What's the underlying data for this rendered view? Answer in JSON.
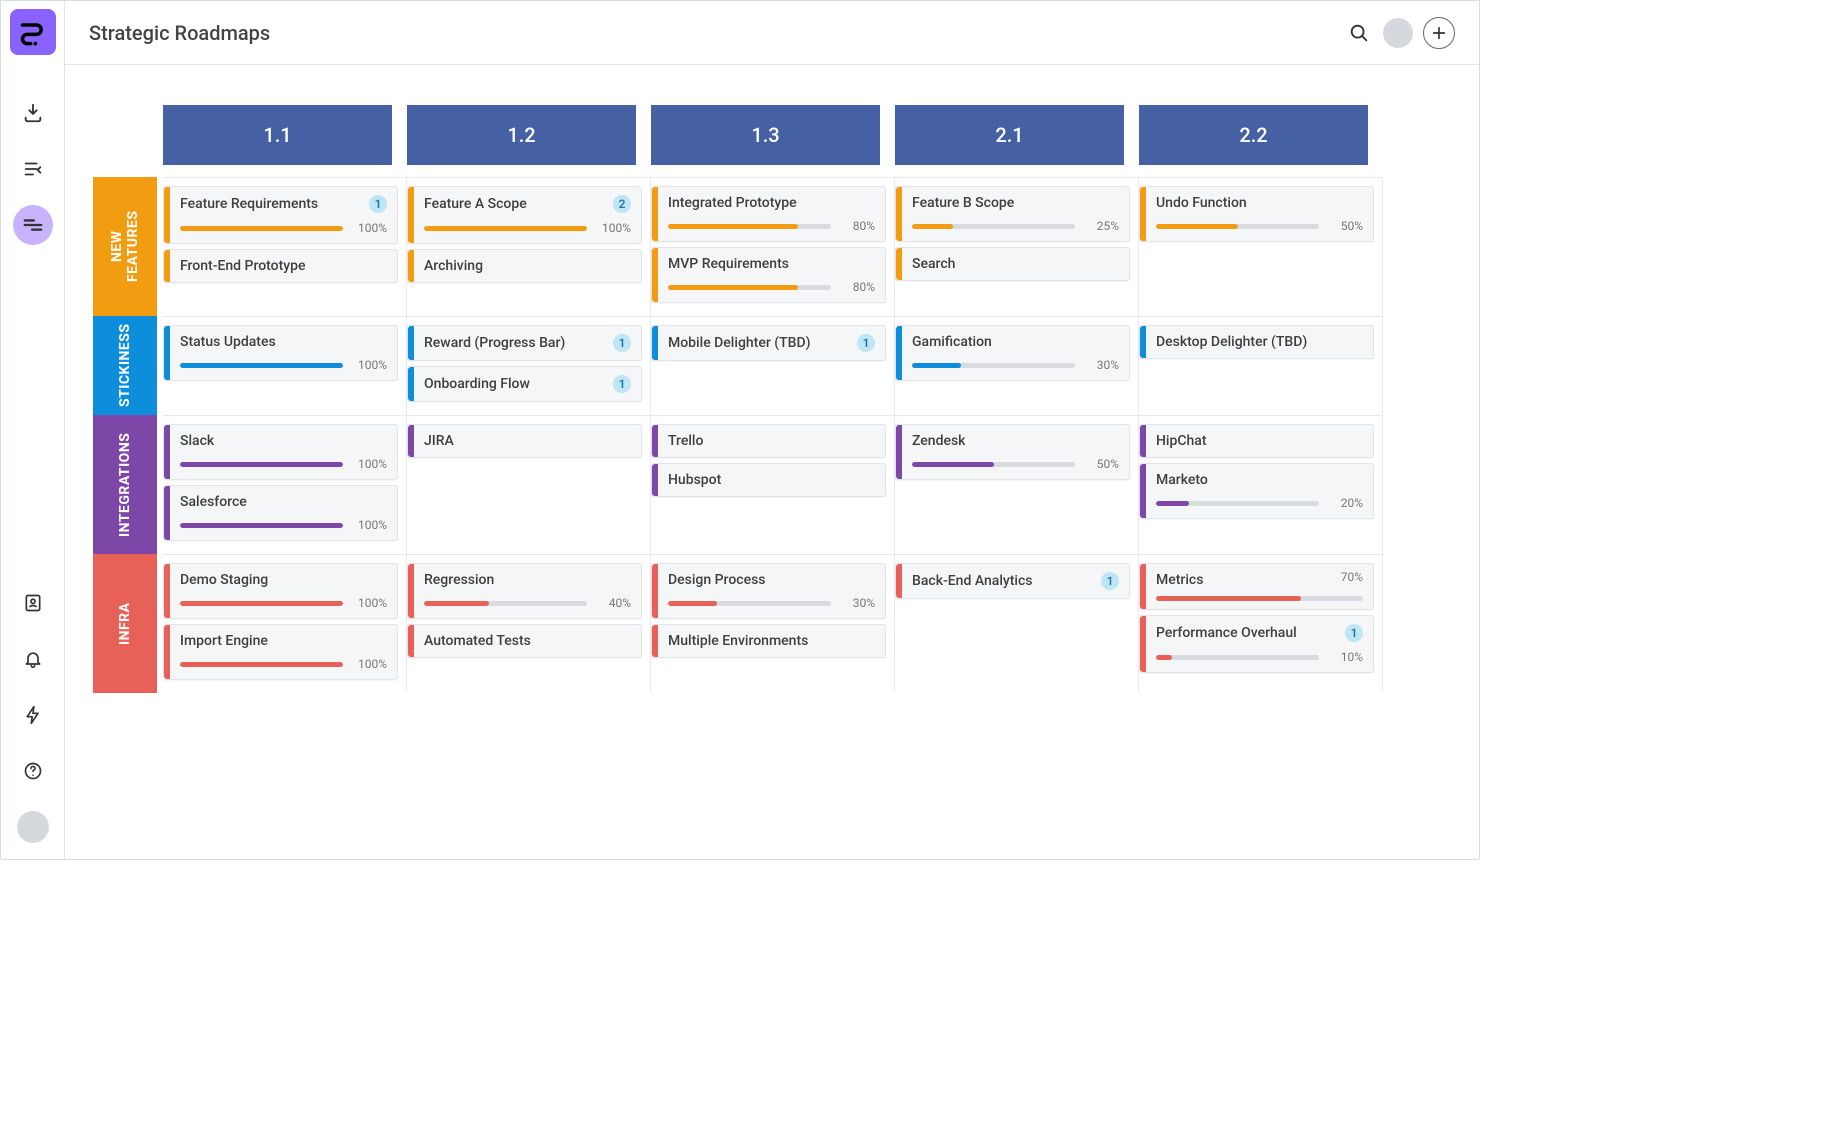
{
  "page_title": "Strategic Roadmaps",
  "columns": [
    "1.1",
    "1.2",
    "1.3",
    "2.1",
    "2.2"
  ],
  "lanes": [
    {
      "id": "new-features",
      "label": "NEW\nFEATURES",
      "color": "orange",
      "rows": [
        [
          {
            "title": "Feature Requirements",
            "badge": 1,
            "progress": 100
          },
          {
            "title": "Front-End Prototype"
          }
        ],
        [
          {
            "title": "Feature A Scope",
            "badge": 2,
            "progress": 100
          },
          {
            "title": "Archiving"
          }
        ],
        [
          {
            "title": "Integrated Prototype",
            "progress": 80
          },
          {
            "title": "MVP Requirements",
            "progress": 80
          }
        ],
        [
          {
            "title": "Feature B Scope",
            "progress": 25
          },
          {
            "title": "Search"
          }
        ],
        [
          {
            "title": "Undo Function",
            "progress": 50
          }
        ]
      ]
    },
    {
      "id": "stickiness",
      "label": "STICKINESS",
      "color": "blue",
      "rows": [
        [
          {
            "title": "Status Updates",
            "progress": 100
          }
        ],
        [
          {
            "title": "Reward (Progress Bar)",
            "badge": 1
          },
          {
            "title": "Onboarding Flow",
            "badge": 1
          }
        ],
        [
          {
            "title": "Mobile Delighter (TBD)",
            "badge": 1
          }
        ],
        [
          {
            "title": "Gamification",
            "progress": 30
          }
        ],
        [
          {
            "title": "Desktop Delighter (TBD)"
          }
        ]
      ]
    },
    {
      "id": "integrations",
      "label": "INTEGRATIONS",
      "color": "purple",
      "rows": [
        [
          {
            "title": "Slack",
            "progress": 100
          },
          {
            "title": "Salesforce",
            "progress": 100
          }
        ],
        [
          {
            "title": "JIRA"
          }
        ],
        [
          {
            "title": "Trello"
          },
          {
            "title": "Hubspot"
          }
        ],
        [
          {
            "title": "Zendesk",
            "progress": 50
          }
        ],
        [
          {
            "title": "HipChat"
          },
          {
            "title": "Marketo",
            "progress": 20
          }
        ]
      ]
    },
    {
      "id": "infra",
      "label": "INFRA",
      "color": "red",
      "rows": [
        [
          {
            "title": "Demo Staging",
            "progress": 100
          },
          {
            "title": "Import Engine",
            "progress": 100
          }
        ],
        [
          {
            "title": "Regression",
            "progress": 40
          },
          {
            "title": "Automated Tests"
          }
        ],
        [
          {
            "title": "Design Process",
            "progress": 30
          },
          {
            "title": "Multiple Environments"
          }
        ],
        [
          {
            "title": "Back-End Analytics",
            "badge": 1
          }
        ],
        [
          {
            "title": "Metrics",
            "progress": 70,
            "pct_top": true
          },
          {
            "title": "Performance Overhaul",
            "badge": 1,
            "progress": 10
          }
        ]
      ]
    }
  ]
}
